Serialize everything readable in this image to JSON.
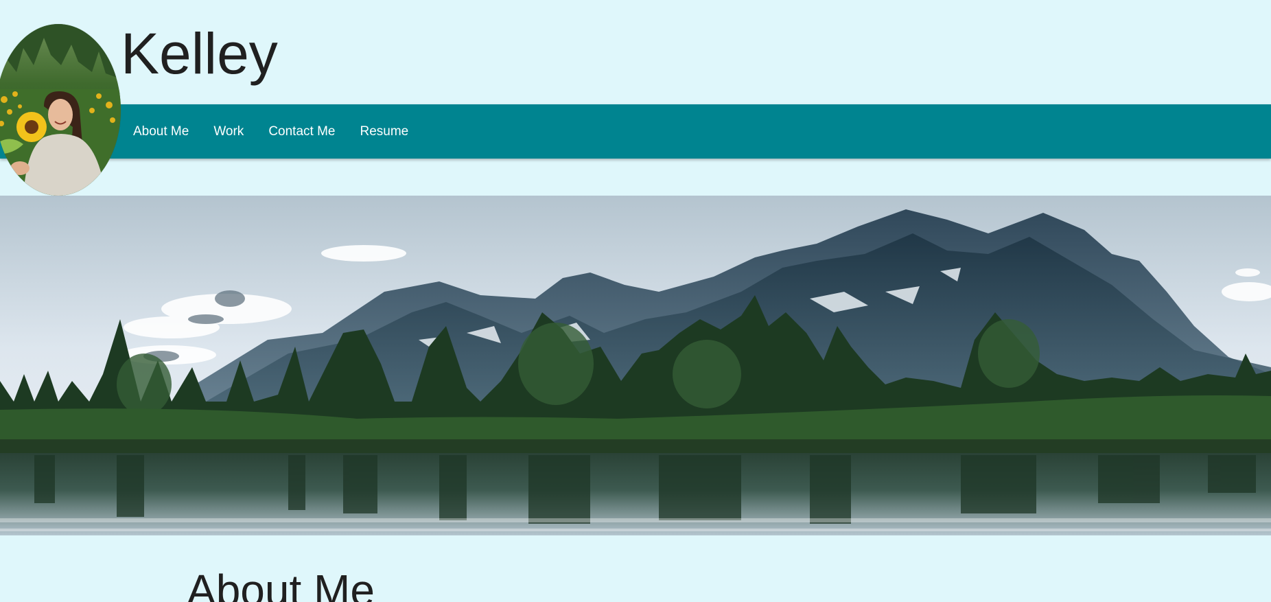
{
  "site": {
    "title": "Kelley"
  },
  "nav": {
    "items": [
      {
        "label": "About Me"
      },
      {
        "label": "Work"
      },
      {
        "label": "Contact Me"
      },
      {
        "label": "Resume"
      }
    ]
  },
  "sections": {
    "about_heading": "About Me"
  },
  "colors": {
    "page_background": "#dff7fb",
    "navbar": "#008490",
    "nav_text": "#ffffff",
    "heading_text": "#202020"
  },
  "images": {
    "avatar": "profile-photo",
    "hero": "mountain-lake-banner"
  }
}
